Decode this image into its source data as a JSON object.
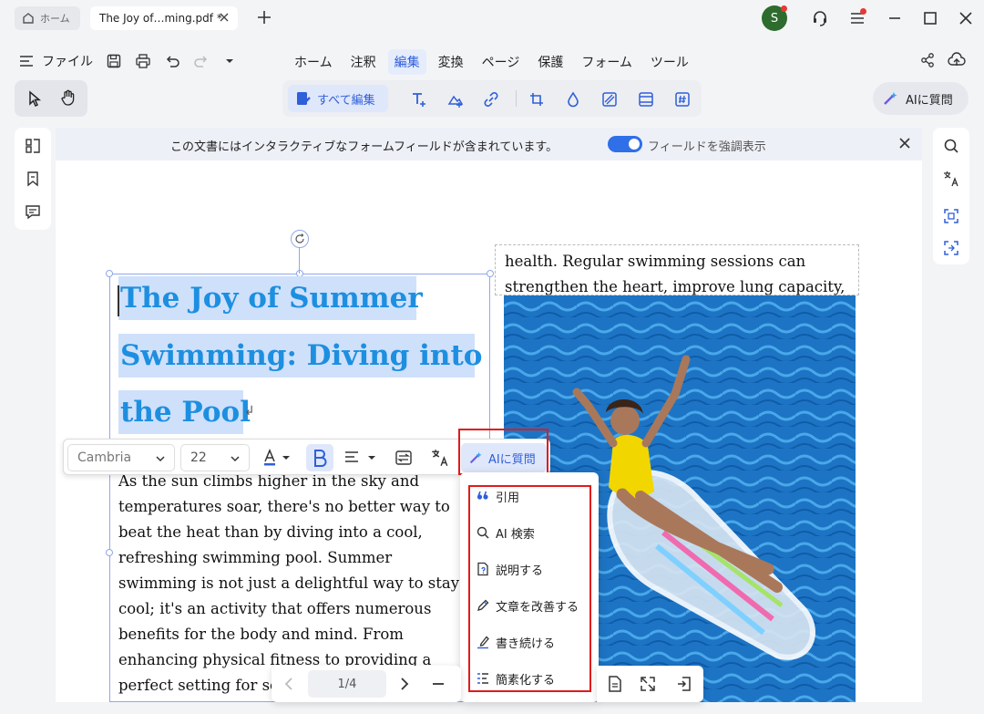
{
  "tabs": {
    "home_label": "ホーム",
    "doc_label": "The Joy of…ming.pdf *"
  },
  "user": {
    "avatar_letter": "S"
  },
  "menu": {
    "file_label": "ファイル",
    "items": [
      "ホーム",
      "注釈",
      "編集",
      "変換",
      "ページ",
      "保護",
      "フォーム",
      "ツール"
    ],
    "active": "編集"
  },
  "toolbar": {
    "edit_all_label": "すべて編集",
    "ai_ask_label": "AIに質問"
  },
  "notice": {
    "message": "この文書にはインタラクティブなフォームフィールドが含まれています。",
    "toggle_label": "フィールドを強調表示",
    "toggle_on": true
  },
  "document": {
    "title_lines": [
      "The Joy of Summer ",
      "Swimming: Diving into ",
      "the Pool"
    ],
    "return_mark": "↲",
    "body_lines": [
      "As the sun climbs higher in the sky and",
      "temperatures soar, there's no better way to",
      "beat the heat than by diving into a cool,",
      "refreshing swimming pool. Summer",
      "swimming is not just a delightful way to stay",
      "cool; it's an activity that offers numerous",
      "benefits for the body and mind. From",
      "enhancing physical fitness to providing a",
      "perfect setting for so"
    ],
    "right_lines": [
      "health. Regular swimming sessions can",
      "strengthen the heart, improve lung capacity,"
    ]
  },
  "format_toolbar": {
    "font": "Cambria",
    "size": "22",
    "ai_label": "AIに質問"
  },
  "ai_menu": {
    "items": [
      {
        "label": "引用",
        "icon": "quote-icon"
      },
      {
        "label": "AI 検索",
        "icon": "search-icon"
      },
      {
        "label": "説明する",
        "icon": "explain-doc-icon"
      },
      {
        "label": "文章を改善する",
        "icon": "pen-icon"
      },
      {
        "label": "書き続ける",
        "icon": "continue-writing-icon"
      },
      {
        "label": "簡素化する",
        "icon": "simplify-icon"
      }
    ]
  },
  "page_nav": {
    "page": "1/4"
  },
  "colors": {
    "accent": "#2f5fd9",
    "title_text": "#1d8fe0",
    "selection": "#cfe0fb",
    "highlight_box": "#e01b1b"
  }
}
